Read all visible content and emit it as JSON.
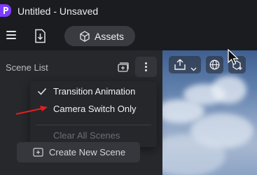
{
  "app": {
    "title": "Untitled - Unsaved",
    "logo_icon": "app-logo-icon",
    "accent": "#7d3cff"
  },
  "toolbar": {
    "menu_icon": "hamburger-menu-icon",
    "import_icon": "file-import-icon",
    "assets_label": "Assets",
    "assets_icon": "cube-icon"
  },
  "sidebar": {
    "title": "Scene List",
    "add_icon": "add-scene-icon",
    "more_icon": "more-vertical-icon"
  },
  "dropdown": {
    "items": [
      {
        "label": "Transition Animation",
        "checked": true,
        "enabled": true
      },
      {
        "label": "Camera Switch Only",
        "checked": false,
        "enabled": true
      },
      {
        "label": "Clear All Scenes",
        "checked": false,
        "enabled": false
      }
    ]
  },
  "create_scene": {
    "label": "Create New Scene",
    "icon": "add-scene-icon"
  },
  "preview": {
    "tools": [
      "share-icon",
      "globe-icon",
      "add-model-icon"
    ]
  },
  "annotation": {
    "arrow_color": "#e02020"
  }
}
